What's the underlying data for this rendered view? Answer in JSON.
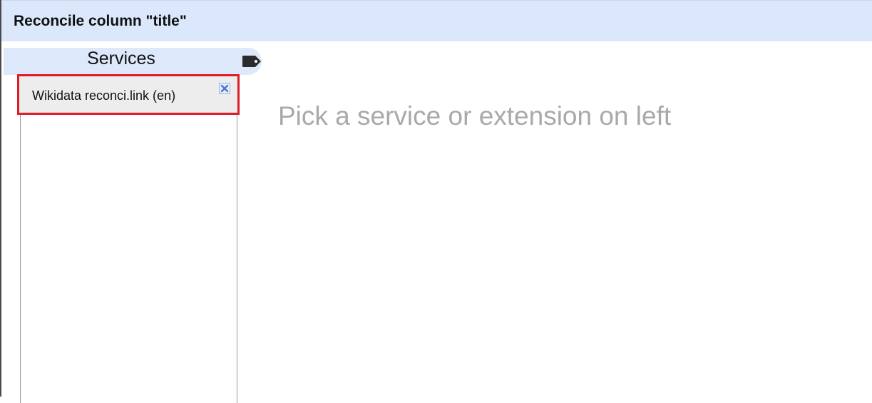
{
  "dialog": {
    "title": "Reconcile column \"title\""
  },
  "services_panel": {
    "label": "Services",
    "tag_icon": "tag-icon",
    "items": [
      {
        "label": "Wikidata reconci.link (en)",
        "remove_icon": "close-icon",
        "highlight_color": "#e01b2a"
      }
    ]
  },
  "main": {
    "placeholder": "Pick a service or extension on left"
  },
  "colors": {
    "header_bg": "#dbe8fb",
    "tab_bg": "#dde9fb",
    "item_bg": "#ededed",
    "placeholder_text": "#a9a9a9"
  }
}
